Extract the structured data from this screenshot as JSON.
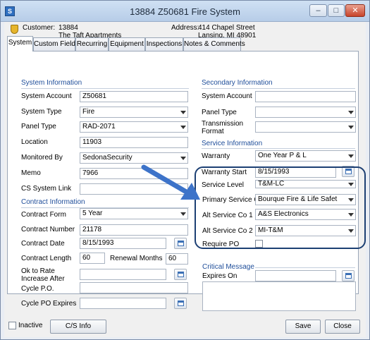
{
  "window": {
    "title": "13884 Z50681 Fire System",
    "icon_letter": "S",
    "minimize_label": "–",
    "maximize_label": "□",
    "close_label": "✕"
  },
  "header": {
    "customer_label": "Customer:",
    "customer_number": "13884",
    "customer_name": "The Taft Apartments",
    "address_label": "Address:",
    "address_line1": "414 Chapel Street",
    "address_line2": "Lansing, MI  48901"
  },
  "tabs": [
    "System",
    "Custom Fields",
    "Recurring",
    "Equipment",
    "Inspections",
    "Notes & Comments"
  ],
  "system_info": {
    "title": "System Information",
    "system_account_label": "System Account",
    "system_account_value": "Z50681",
    "system_type_label": "System Type",
    "system_type_value": "Fire",
    "panel_type_label": "Panel Type",
    "panel_type_value": "RAD-2071",
    "location_label": "Location",
    "location_value": "11903",
    "monitored_by_label": "Monitored By",
    "monitored_by_value": "SedonaSecurity",
    "memo_label": "Memo",
    "memo_value": "7966",
    "cs_system_link_label": "CS System Link",
    "cs_system_link_value": ""
  },
  "contract_info": {
    "title": "Contract Information",
    "contract_form_label": "Contract Form",
    "contract_form_value": "5 Year",
    "contract_number_label": "Contract Number",
    "contract_number_value": "21178",
    "contract_date_label": "Contract Date",
    "contract_date_value": "8/15/1993",
    "contract_length_label": "Contract Length",
    "contract_length_value": "60",
    "renewal_months_label": "Renewal Months",
    "renewal_months_value": "60",
    "ok_to_rate_label": "Ok to Rate Increase After",
    "ok_to_rate_value": "",
    "cycle_po_label": "Cycle P.O.",
    "cycle_po_value": "",
    "cycle_po_expires_label": "Cycle PO Expires",
    "cycle_po_expires_value": ""
  },
  "secondary_info": {
    "title": "Secondary Information",
    "system_account_label": "System Account",
    "system_account_value": "",
    "panel_type_label": "Panel Type",
    "panel_type_value": "",
    "transmission_format_label": "Transmission Format",
    "transmission_format_value": ""
  },
  "service_info": {
    "title": "Service Information",
    "warranty_label": "Warranty",
    "warranty_value": "One Year P & L",
    "warranty_start_label": "Warranty Start",
    "warranty_start_value": "8/15/1993",
    "service_level_label": "Service Level",
    "service_level_value": "T&M-LC",
    "primary_service_co_label": "Primary Service Co",
    "primary_service_co_value": "Bourque Fire & Life Safet",
    "alt_service_co1_label": "Alt Service Co 1",
    "alt_service_co1_value": "A&S Electronics",
    "alt_service_co2_label": "Alt Service Co 2",
    "alt_service_co2_value": "MI-T&M",
    "require_po_label": "Require PO"
  },
  "critical": {
    "title": "Critical Message",
    "expires_on_label": "Expires On",
    "expires_on_value": "",
    "message_value": ""
  },
  "footer": {
    "inactive_label": "Inactive",
    "cs_info_label": "C/S Info",
    "save_label": "Save",
    "close_label": "Close"
  },
  "colors": {
    "section_title": "#1f4e9a",
    "highlight_border": "#1c3f73",
    "arrow": "#3d73c9"
  }
}
